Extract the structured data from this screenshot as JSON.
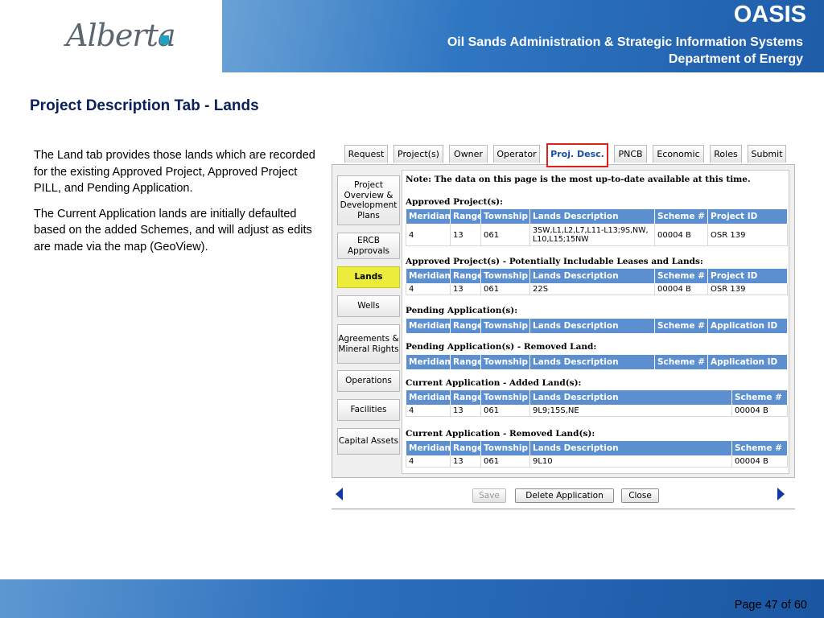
{
  "header": {
    "logo_text": "Alberta",
    "oasis": "OASIS",
    "system_name": "Oil Sands Administration & Strategic Information Systems",
    "department": "Department of Energy"
  },
  "slide": {
    "title": "Project Description Tab - Lands",
    "paragraphs": [
      "The Land tab provides those lands which are recorded for the existing Approved Project, Approved Project PILL, and Pending Application.",
      "The Current Application lands are initially defaulted based on the added Schemes, and will adjust as edits are made via the map (GeoView)."
    ],
    "page_label": "Page 47 of 60"
  },
  "app": {
    "tabs": [
      "Request",
      "Project(s)",
      "Owner",
      "Operator",
      "Proj. Desc.",
      "PNCB",
      "Economic",
      "Roles",
      "Submit"
    ],
    "active_tab": "Proj. Desc.",
    "sidebar": [
      "Project Overview & Development Plans",
      "ERCB Approvals",
      "Lands",
      "Wells",
      "Agreements & Mineral Rights",
      "Operations",
      "Facilities",
      "Capital Assets"
    ],
    "active_sidebar": "Lands",
    "note": "Note: The data on this page is the most up-to-date available at this time.",
    "sections": [
      {
        "title": "Approved Project(s):",
        "columns": [
          "Meridian",
          "Range",
          "Township",
          "Lands Description",
          "Scheme #",
          "Project ID"
        ],
        "rows": [
          [
            "4",
            "13",
            "061",
            "3SW,L1,L2,L7,L11-L13;9S,NW, L10,L15;15NW",
            "00004 B",
            "OSR 139"
          ]
        ]
      },
      {
        "title": "Approved Project(s) - Potentially Includable Leases and Lands:",
        "columns": [
          "Meridian",
          "Range",
          "Township",
          "Lands Description",
          "Scheme #",
          "Project ID"
        ],
        "rows": [
          [
            "4",
            "13",
            "061",
            "22S",
            "00004 B",
            "OSR 139"
          ]
        ]
      },
      {
        "title": "Pending Application(s):",
        "columns": [
          "Meridian",
          "Range",
          "Township",
          "Lands Description",
          "Scheme #",
          "Application ID"
        ],
        "rows": []
      },
      {
        "title": "Pending Application(s) - Removed Land:",
        "columns": [
          "Meridian",
          "Range",
          "Township",
          "Lands Description",
          "Scheme #",
          "Application ID"
        ],
        "rows": []
      },
      {
        "title": "Current Application - Added Land(s):",
        "columns": [
          "Meridian",
          "Range",
          "Township",
          "Lands Description",
          "Scheme #"
        ],
        "rows": [
          [
            "4",
            "13",
            "061",
            "9L9;15S,NE",
            "00004 B"
          ]
        ]
      },
      {
        "title": "Current Application - Removed Land(s):",
        "columns": [
          "Meridian",
          "Range",
          "Township",
          "Lands Description",
          "Scheme #"
        ],
        "rows": [
          [
            "4",
            "13",
            "061",
            "9L10",
            "00004 B"
          ]
        ]
      }
    ],
    "buttons": {
      "save": "Save",
      "delete": "Delete Application",
      "close": "Close"
    }
  }
}
